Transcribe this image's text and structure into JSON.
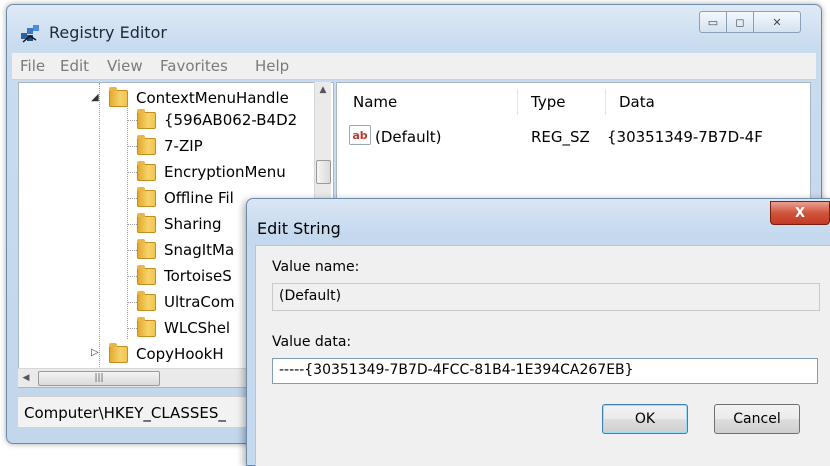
{
  "registry_editor": {
    "title": "Registry Editor",
    "menu": [
      "File",
      "Edit",
      "View",
      "Favorites",
      "Help"
    ],
    "tree": {
      "parent": "ContextMenuHandle",
      "children": [
        "{596AB062-B4D2",
        "7-ZIP",
        "EncryptionMenu",
        "Offline Fil",
        "Sharing",
        "SnagItMa",
        "TortoiseS",
        "UltraCom",
        "WLCShel"
      ],
      "next_sibling": "CopyHookH"
    },
    "list": {
      "columns": [
        "Name",
        "Type",
        "Data"
      ],
      "rows": [
        {
          "icon": "ab",
          "name": "(Default)",
          "type": "REG_SZ",
          "data": "{30351349-7B7D-4F"
        }
      ]
    },
    "status_bar": "Computer\\HKEY_CLASSES_"
  },
  "dialog": {
    "title": "Edit String",
    "close_label": "X",
    "value_name_label": "Value name:",
    "value_name": "(Default)",
    "value_data_label": "Value data:",
    "value_data": "-----{30351349-7B7D-4FCC-81B4-1E394CA267EB}",
    "ok_label": "OK",
    "cancel_label": "Cancel"
  },
  "icons": {
    "app": "registry-editor-icon",
    "folder": "folder-icon",
    "string_value": "string-value-icon"
  }
}
